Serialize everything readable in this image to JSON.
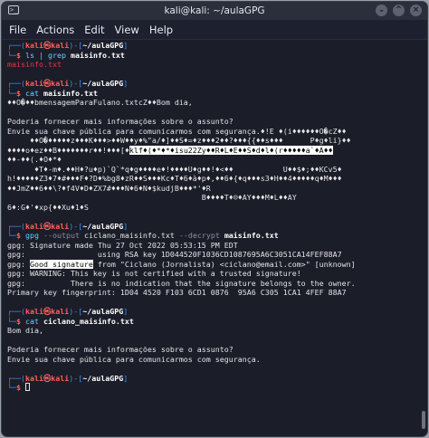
{
  "window": {
    "title": "kali@kali: ~/aulaGPG",
    "controls": [
      "⌄",
      "^",
      "×"
    ]
  },
  "menu": [
    "File",
    "Actions",
    "Edit",
    "View",
    "Help"
  ],
  "prompt": {
    "user": "kali",
    "at": "㉿",
    "host": "kali",
    "path": "~/aulaGPG"
  },
  "blocks": [
    {
      "command": "ls",
      "pipe": "|",
      "command2": "grep",
      "arg": "maisinfo.txt",
      "output": [
        "maisinfo.txt"
      ]
    },
    {
      "command": "cat",
      "arg": "maisinfo.txt",
      "output": [
        "♦♦O�♦♦bmensagemParaFulano.txtcZ♦♦Bom dia,",
        "",
        "Poderia fornecer mais informações sobre o assunto?",
        "Envie sua chave pública para comunicarmos com segurança.♦!E ♦(i♦♦♦♦♦♦O�cZ♦♦",
        "     ♦♦O�♦♦♦♦♦z♦♦♦K♦♦♦>♦♦W♦♦y♦%\"a/♦]♦♦S♦=♦z♦♦♦2♦♦?♦♦♦{{♦♦s♦♦♦      P♦g♦li}♦♦",
        "♦♦♦♦o♦ez♦♦B♦♦♦♦♦♦♦r♦♦!♦♦♦[♦|klf♦(♦*♦*♦isu22Zy♦♦R♦L♦E♦♦S♦d♦l♦(r♦♦♦♦♦a`♦A♦♦",
        "♦♦-♦♦(.♦O♦*♦",
        "      ♦T♦-m♦.♦♦H♦?u♦p)`Q`*q♦g♦♦♦♦e♦!♦♦♦♦U♦g♦♦!♦<♦♦           U♦♦$♦;♦♦KCv5♦",
        "h!♦♦♦♦♦Z3♦7♦#♦♦♦F♦?D♦%bg8♦zR♦♦S♦♦♦Kc♦T♦6♦à♦p♦,♦♦6♦{♦q♦♦♦s3♦H♦♦4♦♦♦♦♦q♦M♦♦♦",
        "♦♦JmZ♦♦6♦♦\\?♦f4V♦D♦ZX7#♦♦♦N♦6♦N♦$kudjB♦♦♦*'♦R",
        "                                           B♦♦♦♦T♦☺♦AY♦♦♦M♦L♦♦AY",
        "6♦:G♦'♦xp{♦♦Xu♦1♦S"
      ]
    },
    {
      "command": "gpg",
      "opt1": "--output",
      "val1": "ciclano_maisinfo.txt",
      "opt2": "--decrypt",
      "arg": "maisinfo.txt",
      "output": [
        "gpg: Signature made Thu 27 Oct 2022 05:53:15 PM EDT",
        "gpg:                using RSA key 1D044520F1036CD1087695A6C3051CA14FEF88A7",
        "gpg: |Good signature| from \"Ciclano (Jornalista) <ciclano@email.com>\" [unknown]",
        "gpg: WARNING: This key is not certified with a trusted signature!",
        "gpg:          There is no indication that the signature belongs to the owner.",
        "Primary key fingerprint: 1D04 4520 F103 6CD1 0876  95A6 C305 1CA1 4FEF 88A7"
      ]
    },
    {
      "command": "cat",
      "arg": "ciclano_maisinfo.txt",
      "output": [
        "Bom dia,",
        "",
        "Poderia fornecer mais informações sobre o assunto?",
        "Envie sua chave pública para comunicarmos com segurança."
      ]
    }
  ],
  "highlight": "Good signature",
  "icons": {
    "terminal": "terminal-icon"
  }
}
